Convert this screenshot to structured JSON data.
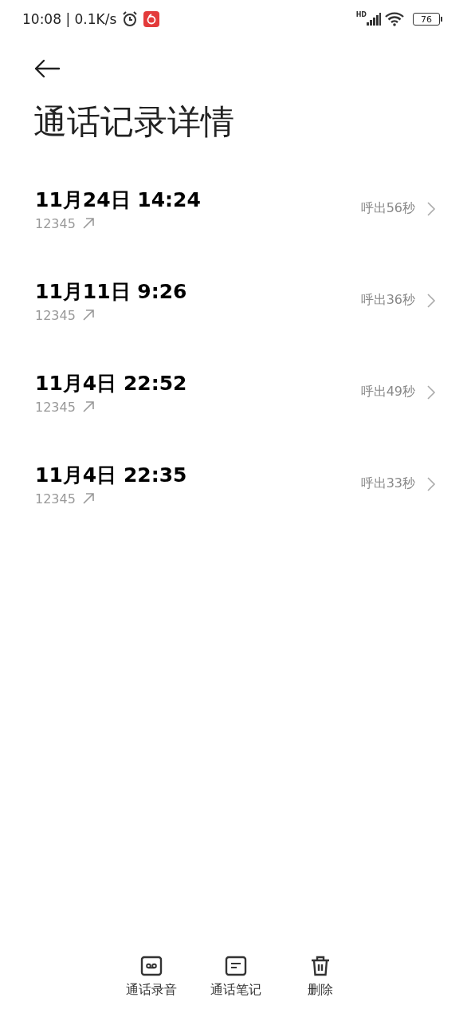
{
  "status_bar": {
    "time_speed": "10:08 | 0.1K/s",
    "network": "HD",
    "battery": "76"
  },
  "header": {
    "title": "通话记录详情"
  },
  "calls": [
    {
      "datetime": "11月24日 14:24",
      "number": "12345",
      "kind": "outgoing",
      "summary": "呼出56秒"
    },
    {
      "datetime": "11月11日 9:26",
      "number": "12345",
      "kind": "outgoing",
      "summary": "呼出36秒"
    },
    {
      "datetime": "11月4日 22:52",
      "number": "12345",
      "kind": "outgoing",
      "summary": "呼出49秒"
    },
    {
      "datetime": "11月4日 22:35",
      "number": "12345",
      "kind": "outgoing",
      "summary": "呼出33秒"
    }
  ],
  "bottom_bar": [
    {
      "label": "通话录音",
      "kind": "recording"
    },
    {
      "label": "通话笔记",
      "kind": "note"
    },
    {
      "label": "删除",
      "kind": "delete"
    }
  ]
}
